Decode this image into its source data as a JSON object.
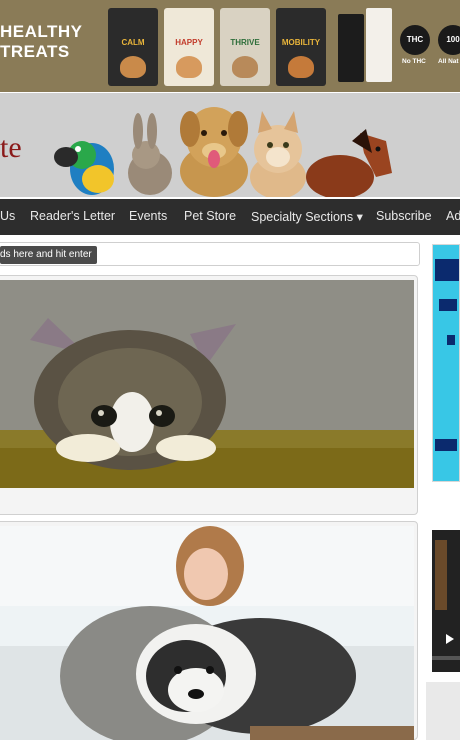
{
  "ad_banner": {
    "headline_line1": "HEALTHY",
    "headline_line2": "TREATS",
    "packs": [
      {
        "label": "CALM",
        "color": "#2b2b2b",
        "text_color": "#e9b53b"
      },
      {
        "label": "HAPPY",
        "color": "#efe8d8",
        "text_color": "#c23b2b"
      },
      {
        "label": "THRIVE",
        "color": "#d9d2c2",
        "text_color": "#2e6e3a"
      },
      {
        "label": "MOBILITY",
        "color": "#2b2b2b",
        "text_color": "#e9b53b"
      }
    ],
    "badges": [
      {
        "text": "THC",
        "caption": "No THC"
      },
      {
        "text": "100",
        "caption": "All Nat"
      }
    ]
  },
  "header": {
    "logo_fragment": "te"
  },
  "nav": {
    "items": [
      "Us",
      "Reader's Letter",
      "Events",
      "Pet Store",
      "Specialty Sections ▾",
      "Subscribe",
      "Ad"
    ]
  },
  "search": {
    "tooltip": "ds here and hit enter"
  }
}
